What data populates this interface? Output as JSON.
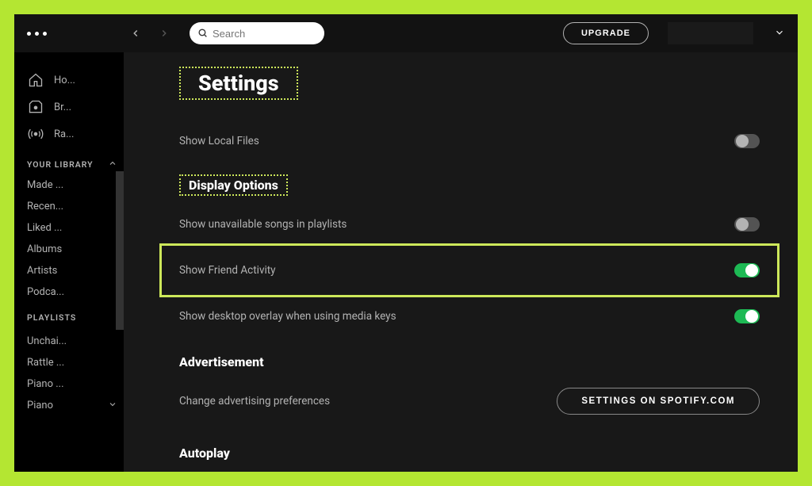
{
  "topbar": {
    "search_placeholder": "Search",
    "upgrade_label": "UPGRADE"
  },
  "sidebar": {
    "nav": {
      "home": "Ho...",
      "browse": "Br...",
      "radio": "Ra..."
    },
    "library_header": "YOUR LIBRARY",
    "library_items": [
      "Made ...",
      "Recen...",
      "Liked ...",
      "Albums",
      "Artists",
      "Podca..."
    ],
    "playlists_header": "PLAYLISTS",
    "playlists": [
      "Unchai...",
      "Rattle ...",
      "Piano ...",
      "Piano"
    ]
  },
  "settings": {
    "title": "Settings",
    "local_files_label": "Show Local Files",
    "sections": {
      "display_options": {
        "title": "Display Options",
        "unavailable_label": "Show unavailable songs in playlists",
        "friend_activity_label": "Show Friend Activity",
        "overlay_label": "Show desktop overlay when using media keys"
      },
      "advertisement": {
        "title": "Advertisement",
        "change_pref_label": "Change advertising preferences",
        "link_button": "SETTINGS ON SPOTIFY.COM"
      },
      "autoplay": {
        "title": "Autoplay"
      }
    },
    "toggles": {
      "local_files": false,
      "unavailable": false,
      "friend_activity": true,
      "overlay": true
    }
  }
}
